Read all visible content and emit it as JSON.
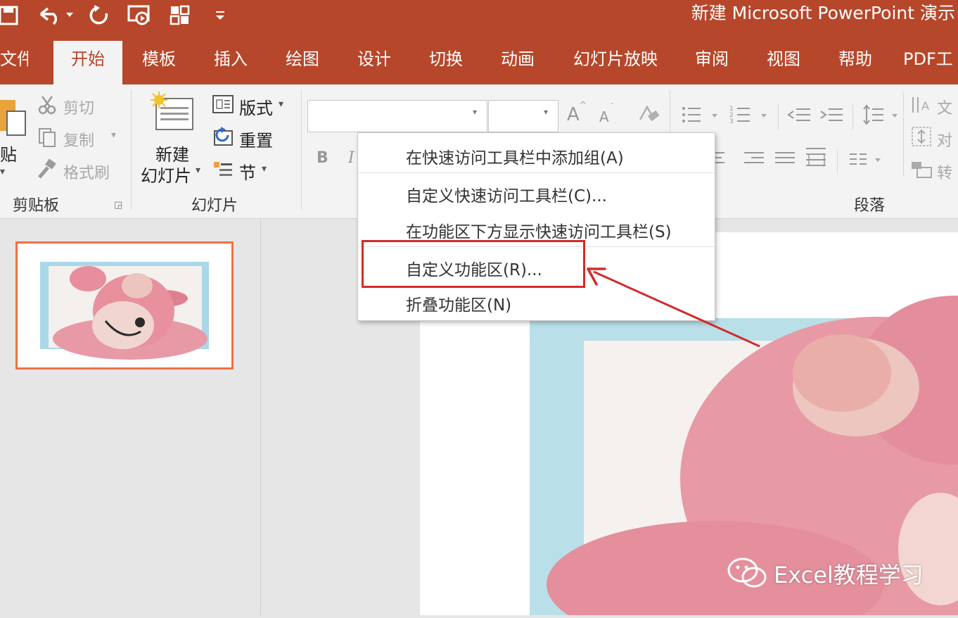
{
  "titlebar": {
    "app_title": "新建 Microsoft PowerPoint 演示",
    "qat_icons": [
      "save-icon",
      "undo-icon",
      "redo-icon",
      "slideshow-from-start-icon",
      "layout-icon",
      "customize-qat-dropdown-icon"
    ]
  },
  "tabs": [
    {
      "label": "文件"
    },
    {
      "label": "开始"
    },
    {
      "label": "模板"
    },
    {
      "label": "插入"
    },
    {
      "label": "绘图"
    },
    {
      "label": "设计"
    },
    {
      "label": "切换"
    },
    {
      "label": "动画"
    },
    {
      "label": "幻灯片放映"
    },
    {
      "label": "审阅"
    },
    {
      "label": "视图"
    },
    {
      "label": "帮助"
    },
    {
      "label": "PDF工"
    }
  ],
  "ribbon": {
    "clipboard": {
      "paste_label": "贴",
      "cut_label": "剪切",
      "copy_label": "复制",
      "format_painter_label": "格式刷",
      "group_label": "剪贴板"
    },
    "slides": {
      "new_slide_label_1": "新建",
      "new_slide_label_2": "幻灯片",
      "layout_label": "版式",
      "reset_label": "重置",
      "section_label": "节",
      "group_label": "幻灯片"
    },
    "font": {
      "bold_label": "B",
      "italic_label": "I",
      "grow_label": "A",
      "shrink_label": "A"
    },
    "paragraph": {
      "group_label": "段落",
      "text_direction_label": "文",
      "align_text_label": "对",
      "convert_label": "转"
    }
  },
  "context_menu": {
    "items": [
      {
        "label": "在快速访问工具栏中添加组(A)"
      },
      {
        "label": "自定义快速访问工具栏(C)..."
      },
      {
        "label": "在功能区下方显示快速访问工具栏(S)"
      },
      {
        "label": "自定义功能区(R)..."
      },
      {
        "label": "折叠功能区(N)"
      }
    ],
    "highlighted_item": "自定义功能区(R)...",
    "highlight_color": "#d22b2b"
  },
  "thumbnail": {
    "selected_border_color": "#f07047"
  },
  "watermark": {
    "text": "Excel教程学习"
  },
  "colors": {
    "accent": "#b7472a",
    "ribbon_bg": "#f3f3f3",
    "annotation_red": "#d22b2b"
  }
}
